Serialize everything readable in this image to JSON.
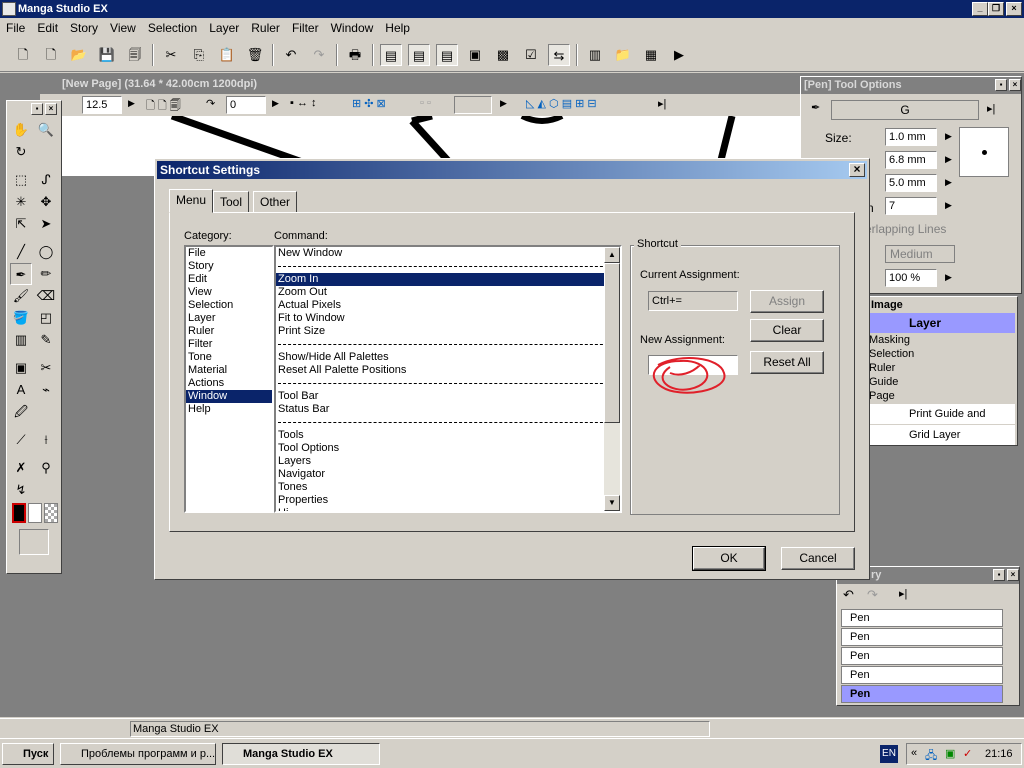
{
  "app": {
    "title": "Manga Studio EX"
  },
  "menu": [
    "File",
    "Edit",
    "Story",
    "View",
    "Selection",
    "Layer",
    "Ruler",
    "Filter",
    "Window",
    "Help"
  ],
  "document": {
    "title": "[New Page] (31.64 * 42.00cm 1200dpi)",
    "zoom": "12.5",
    "rotation": "0"
  },
  "tool_options": {
    "title": "[Pen] Tool Options",
    "preset": "G",
    "size_label": "Size:",
    "size": "1.0 mm",
    "v2": "6.8 mm",
    "v3": "5.0 mm",
    "v4": "7",
    "overlap_label": "verlapping Lines",
    "quality": "Medium",
    "pct": "100 %",
    "n_label": "n"
  },
  "layers": {
    "title": "Image",
    "rows": [
      "Layer",
      "Masking",
      "Selection",
      "Ruler",
      "Guide",
      "Page",
      "Print Guide and Bas...",
      "Grid Layer"
    ]
  },
  "history": {
    "title": "ry",
    "items": [
      "Pen",
      "Pen",
      "Pen",
      "Pen",
      "Pen"
    ]
  },
  "dialog": {
    "title": "Shortcut Settings",
    "tabs": [
      "Menu",
      "Tool",
      "Other"
    ],
    "category_label": "Category:",
    "command_label": "Command:",
    "categories": [
      "File",
      "Story",
      "Edit",
      "View",
      "Selection",
      "Layer",
      "Ruler",
      "Filter",
      "Tone",
      "Material",
      "Actions",
      "Window",
      "Help"
    ],
    "selected_category": "Window",
    "commands": [
      "New Window",
      "---",
      "Zoom In",
      "Zoom Out",
      "Actual Pixels",
      "Fit to Window",
      "Print Size",
      "---",
      "Show/Hide All Palettes",
      "Reset All Palette Positions",
      "---",
      "Tool Bar",
      "Status Bar",
      "---",
      "Tools",
      "Tool Options",
      "Layers",
      "Navigator",
      "Tones",
      "Properties",
      "Hi"
    ],
    "selected_command": "Zoom In",
    "shortcut_group": "Shortcut",
    "current_label": "Current Assignment:",
    "current_value": "Ctrl+=",
    "new_label": "New Assignment:",
    "new_value": "",
    "assign": "Assign",
    "clear": "Clear",
    "reset_all": "Reset All",
    "ok": "OK",
    "cancel": "Cancel"
  },
  "status": {
    "text": "Manga Studio EX"
  },
  "taskbar": {
    "start": "Пуск",
    "task1": "Проблемы программ и р...",
    "task2": "Manga Studio EX",
    "lang": "EN",
    "time": "21:16"
  },
  "colors": {
    "titlebar": "#0a246a",
    "selection": "#0a246a",
    "annotation": "#e0202a",
    "layer_highlight": "#9999ff"
  }
}
